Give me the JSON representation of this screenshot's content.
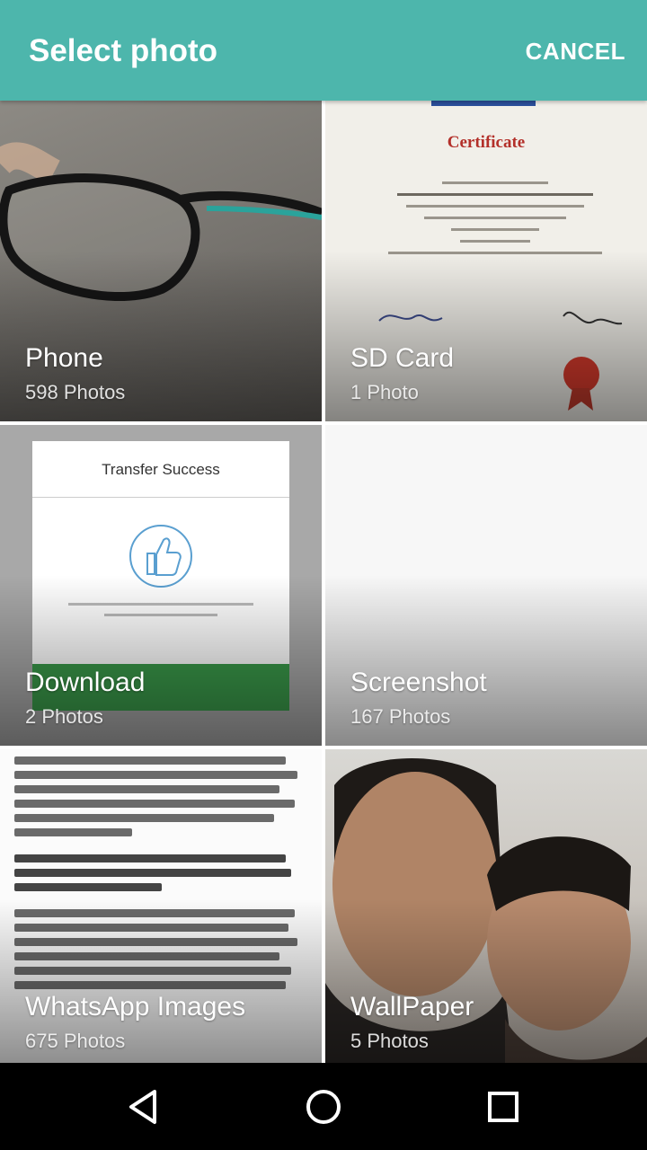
{
  "app_bar": {
    "title": "Select photo",
    "cancel_label": "CANCEL",
    "color": "#4db6ac"
  },
  "albums": [
    {
      "name": "Phone",
      "count": "598 Photos",
      "thumbnail": "eyeglasses-photo"
    },
    {
      "name": "SD Card",
      "count": "1 Photo",
      "thumbnail": "certificate-photo"
    },
    {
      "name": "Download",
      "count": "2 Photos",
      "thumbnail": "transfer-success-screenshot"
    },
    {
      "name": "Screenshot",
      "count": "167 Photos",
      "thumbnail": "blank-screenshot"
    },
    {
      "name": "WhatsApp Images",
      "count": "675 Photos",
      "thumbnail": "document-text-photo"
    },
    {
      "name": "WallPaper",
      "count": "5 Photos",
      "thumbnail": "selfie-photo"
    }
  ],
  "thumbnail_text": {
    "certificate_title": "Certificate",
    "transfer_title": "Transfer Success"
  },
  "nav_bar": {
    "icons": [
      "back-triangle-icon",
      "home-circle-icon",
      "recents-square-icon"
    ]
  }
}
